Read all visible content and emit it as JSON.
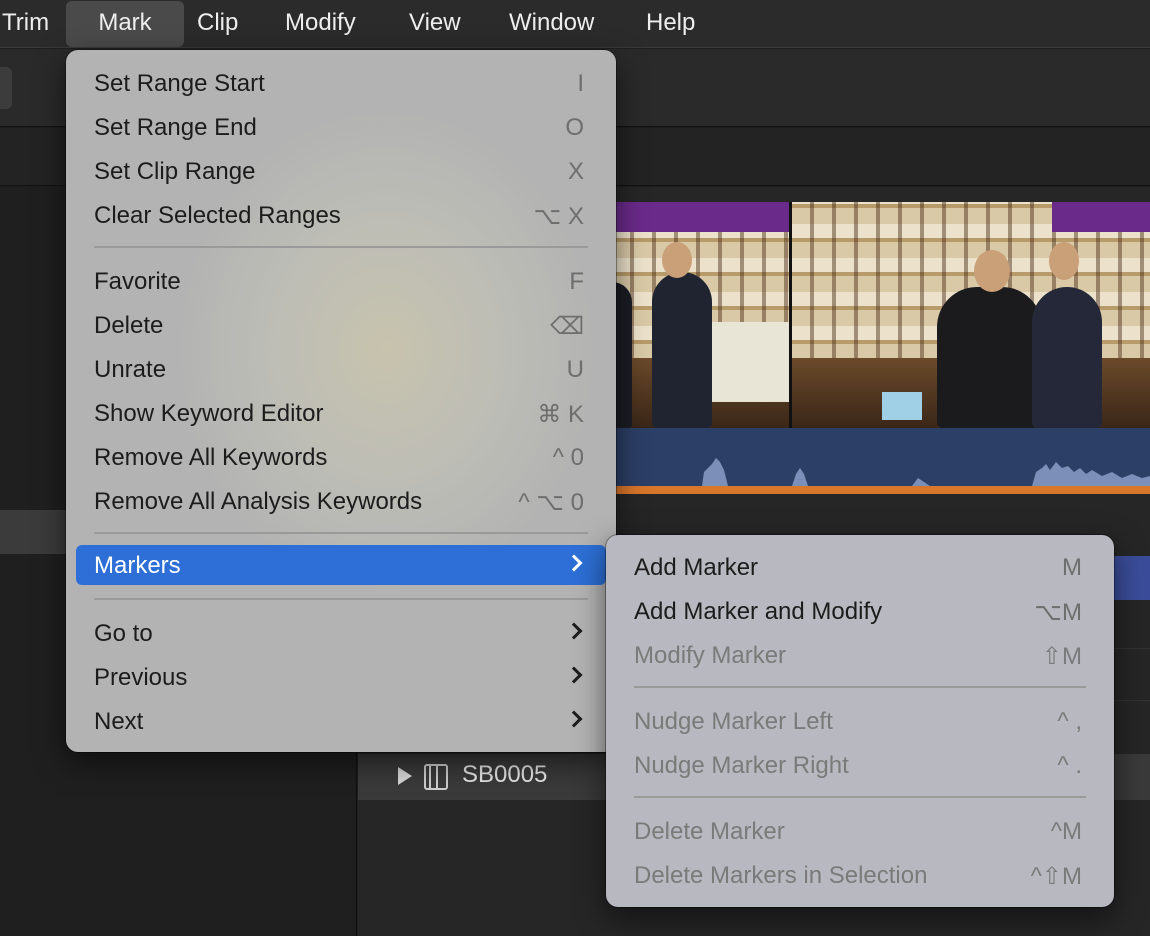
{
  "menubar": {
    "items": [
      "Trim",
      "Mark",
      "Clip",
      "Modify",
      "View",
      "Window",
      "Help"
    ],
    "active": "Mark"
  },
  "mark_menu": {
    "items": [
      {
        "label": "Set Range Start",
        "shortcut": "I"
      },
      {
        "label": "Set Range End",
        "shortcut": "O"
      },
      {
        "label": "Set Clip Range",
        "shortcut": "X"
      },
      {
        "label": "Clear Selected Ranges",
        "shortcut": "⌥ X"
      },
      {
        "label": "Favorite",
        "shortcut": "F"
      },
      {
        "label": "Delete",
        "shortcut": "⌫"
      },
      {
        "label": "Unrate",
        "shortcut": "U"
      },
      {
        "label": "Show Keyword Editor",
        "shortcut": "⌘ K"
      },
      {
        "label": "Remove All Keywords",
        "shortcut": "^ 0"
      },
      {
        "label": "Remove All Analysis Keywords",
        "shortcut": "^ ⌥ 0"
      },
      {
        "label": "Markers",
        "shortcut": "",
        "submenu": true,
        "selected": true
      },
      {
        "label": "Go to",
        "shortcut": "",
        "submenu": true
      },
      {
        "label": "Previous",
        "shortcut": "",
        "submenu": true
      },
      {
        "label": "Next",
        "shortcut": "",
        "submenu": true
      }
    ]
  },
  "markers_menu": {
    "items": [
      {
        "label": "Add Marker",
        "shortcut": "M",
        "enabled": true
      },
      {
        "label": "Add Marker and Modify",
        "shortcut": "⌥M",
        "enabled": true
      },
      {
        "label": "Modify Marker",
        "shortcut": "⇧M",
        "enabled": false
      },
      {
        "label": "Nudge Marker Left",
        "shortcut": "^ ,",
        "enabled": false
      },
      {
        "label": "Nudge Marker Right",
        "shortcut": "^ .",
        "enabled": false
      },
      {
        "label": "Delete Marker",
        "shortcut": "^M",
        "enabled": false
      },
      {
        "label": "Delete Markers in Selection",
        "shortcut": "^⇧M",
        "enabled": false
      }
    ]
  },
  "browser": {
    "clip_row": {
      "label": "SB0005"
    }
  },
  "colors": {
    "selection_blue": "#2d6fd6",
    "audio_wave_bg": "#2c3f66",
    "range_orange": "#d8762a"
  }
}
